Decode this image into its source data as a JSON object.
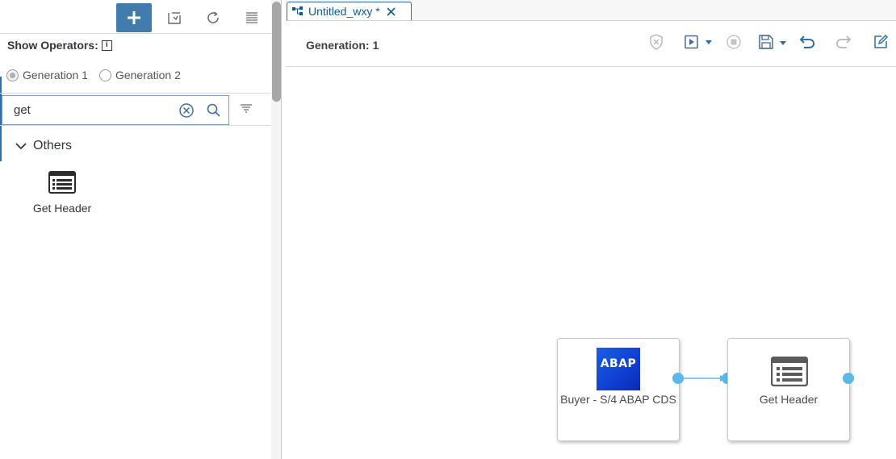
{
  "left_panel": {
    "toolbar": {
      "add_icon": "plus-icon",
      "open_icon": "open-graph-icon",
      "refresh_icon": "refresh-icon",
      "list_icon": "list-icon"
    },
    "show_operators_label": "Show Operators:",
    "info_icon_text": "i",
    "generations": [
      {
        "label": "Generation 1",
        "selected": true
      },
      {
        "label": "Generation 2",
        "selected": false
      }
    ],
    "search": {
      "value": "get",
      "placeholder": ""
    },
    "group": {
      "label": "Others",
      "expanded": true
    },
    "operators": [
      {
        "label": "Get Header",
        "icon": "list-icon"
      }
    ]
  },
  "editor": {
    "tab": {
      "title": "Untitled_wxy *"
    },
    "generation_label": "Generation: 1",
    "toolbar": [
      "validate-icon",
      "run-icon",
      "stop-icon",
      "save-icon",
      "undo-icon",
      "redo-icon",
      "edit-icon"
    ],
    "nodes": [
      {
        "label": "Buyer - S/4 ABAP CDS",
        "logo_text": "ABAP"
      },
      {
        "label": "Get Header",
        "icon": "list-icon"
      }
    ]
  },
  "colors": {
    "accent": "#427cac",
    "tab_text": "#0b5aa2",
    "port": "#5bb8e8",
    "abap_blue": "#1a5fe6"
  }
}
